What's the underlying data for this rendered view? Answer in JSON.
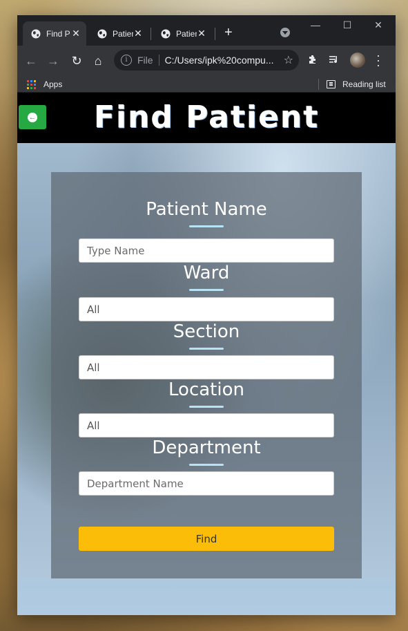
{
  "browser": {
    "tabs": [
      {
        "title": "Find P"
      },
      {
        "title": "Patien"
      },
      {
        "title": "Patien"
      }
    ],
    "new_tab_symbol": "+",
    "address": {
      "scheme_label": "File",
      "url": "C:/Users/ipk%20compu..."
    },
    "bookmarks": {
      "apps_label": "Apps",
      "reading_list_label": "Reading list"
    },
    "icons": [
      "globe-icon",
      "close-icon",
      "back-icon",
      "forward-icon",
      "reload-icon",
      "home-icon",
      "info-icon",
      "star-icon",
      "extensions-icon",
      "media-icon",
      "menu-icon"
    ]
  },
  "header": {
    "title": "Find Patient",
    "back_icon": "arrow-left-circle-icon",
    "back_color": "#26a843"
  },
  "form": {
    "fields": [
      {
        "title": "Patient Name",
        "placeholder": "Type Name",
        "value": ""
      },
      {
        "title": "Ward",
        "placeholder": "",
        "value": "All"
      },
      {
        "title": "Section",
        "placeholder": "",
        "value": "All"
      },
      {
        "title": "Location",
        "placeholder": "",
        "value": "All"
      },
      {
        "title": "Department",
        "placeholder": "Department Name",
        "value": ""
      }
    ],
    "submit_label": "Find",
    "submit_color": "#fbbd08",
    "underline_color": "#b7e3f5"
  }
}
